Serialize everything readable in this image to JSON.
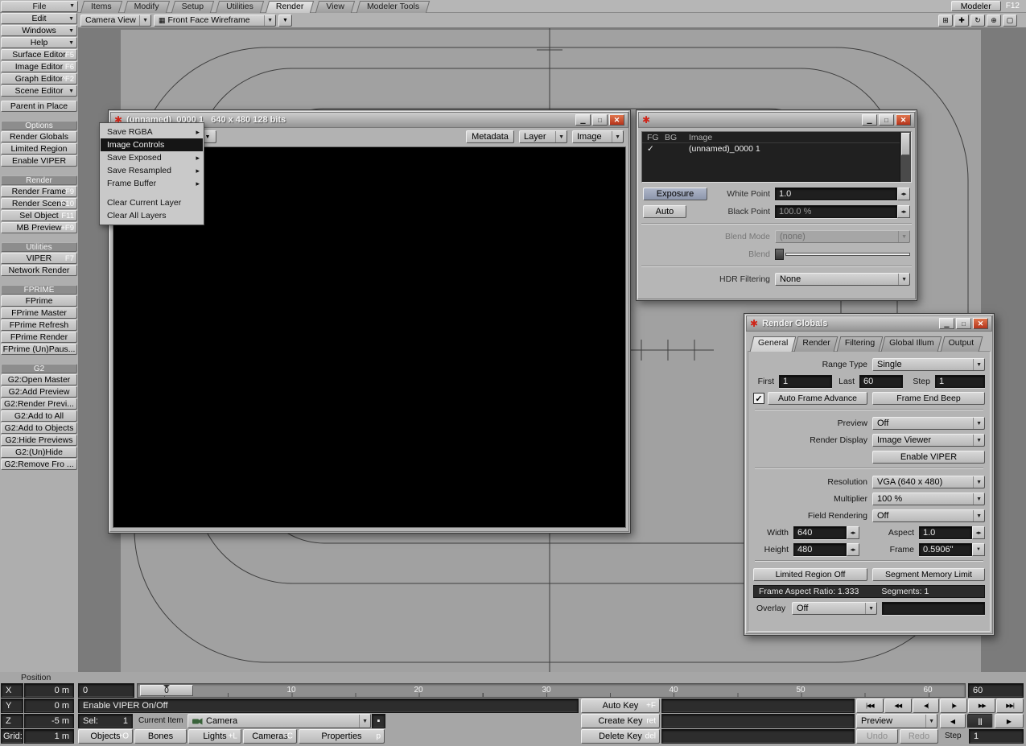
{
  "icons": {
    "dropdown_arrow": "▼",
    "submenu_arrow": "▸",
    "check": "✓",
    "stepper": "◂▸",
    "minimize": "▁",
    "maximize": "□",
    "close": "✕",
    "lightwave_logo": "✱",
    "wireframe_mode": "▦",
    "nav_grid": "⊞",
    "nav_pan": "✚",
    "nav_rotate": "↻",
    "nav_zoom": "⊕",
    "nav_fit": "▢",
    "item_props": "▪"
  },
  "menubar": {
    "file_label": "File",
    "tabs": [
      {
        "label": "Items"
      },
      {
        "label": "Modify"
      },
      {
        "label": "Setup"
      },
      {
        "label": "Utilities"
      },
      {
        "label": "Render",
        "active": true
      },
      {
        "label": "View"
      },
      {
        "label": "Modeler Tools"
      }
    ],
    "modeler_label": "Modeler",
    "modeler_key": "F12"
  },
  "viewbar": {
    "view_mode": "Camera View",
    "shade_mode": "Front Face Wireframe"
  },
  "sidebar": {
    "items": [
      {
        "label": "Edit",
        "menu": true
      },
      {
        "label": "Windows",
        "menu": true
      },
      {
        "label": "Help",
        "menu": true
      },
      {
        "label": "Surface Editor",
        "key": "F5"
      },
      {
        "label": "Image Editor",
        "key": "F6"
      },
      {
        "label": "Graph Editor",
        "key": "^F2"
      },
      {
        "label": "Scene Editor",
        "menu": true
      },
      {
        "gap": true,
        "small": true
      },
      {
        "label": "Parent in Place"
      },
      {
        "gap": true
      },
      {
        "label": "Options",
        "header": true
      },
      {
        "label": "Render Globals"
      },
      {
        "label": "Limited Region"
      },
      {
        "label": "Enable VIPER"
      },
      {
        "gap": true
      },
      {
        "label": "Render",
        "header": true
      },
      {
        "label": "Render Frame",
        "key": "F9"
      },
      {
        "label": "Render Scene",
        "key": "F10"
      },
      {
        "label": "Sel Object",
        "key": "F11"
      },
      {
        "label": "MB Preview",
        "key": "+F9"
      },
      {
        "gap": true
      },
      {
        "label": "Utilities",
        "header": true
      },
      {
        "label": "VIPER",
        "key": "F7"
      },
      {
        "label": "Network Render"
      },
      {
        "gap": true
      },
      {
        "label": "FPRIME",
        "header": true
      },
      {
        "label": "FPrime"
      },
      {
        "label": "FPrime Master"
      },
      {
        "label": "FPrime Refresh"
      },
      {
        "label": "FPrime Render"
      },
      {
        "label": "FPrime (Un)Paus..."
      },
      {
        "gap": true
      },
      {
        "label": "G2",
        "header": true
      },
      {
        "label": "G2:Open Master"
      },
      {
        "label": "G2:Add Preview"
      },
      {
        "label": "G2:Render Previ..."
      },
      {
        "label": "G2:Add to All"
      },
      {
        "label": "G2:Add to Objects"
      },
      {
        "label": "G2:Hide Previews"
      },
      {
        "label": "G2:(Un)Hide"
      },
      {
        "label": "G2:Remove Fro ..."
      }
    ]
  },
  "image_viewer": {
    "title": "(unnamed)_0000 1   640 x 480 128 bits",
    "metadata_label": "Metadata",
    "layer_label": "Layer",
    "image_label": "Image"
  },
  "context_menu": {
    "items": [
      {
        "label": "Save RGBA",
        "submenu": true
      },
      {
        "label": "Image Controls",
        "selected": true
      },
      {
        "label": "Save Exposed",
        "submenu": true
      },
      {
        "label": "Save Resampled",
        "submenu": true
      },
      {
        "label": "Frame Buffer",
        "submenu": true
      },
      {
        "sep": true
      },
      {
        "label": "Clear Current Layer"
      },
      {
        "label": "Clear All Layers"
      }
    ]
  },
  "image_controls": {
    "col_fg": "FG",
    "col_bg": "BG",
    "col_image": "Image",
    "row_image_name": "(unnamed)_0000 1",
    "exposure_label": "Exposure",
    "white_point_label": "White Point",
    "white_point_value": "1.0",
    "auto_label": "Auto",
    "black_point_label": "Black Point",
    "black_point_value": "100.0 %",
    "blend_mode_label": "Blend Mode",
    "blend_mode_value": "(none)",
    "blend_label": "Blend",
    "hdr_filtering_label": "HDR Filtering",
    "hdr_filtering_value": "None"
  },
  "render_globals": {
    "title": "Render Globals",
    "tabs": [
      {
        "label": "General",
        "active": true
      },
      {
        "label": "Render"
      },
      {
        "label": "Filtering"
      },
      {
        "label": "Global Illum"
      },
      {
        "label": "Output"
      }
    ],
    "range_type_label": "Range Type",
    "range_type_value": "Single",
    "first_label": "First",
    "first_value": "1",
    "last_label": "Last",
    "last_value": "60",
    "step_label": "Step",
    "step_value": "1",
    "auto_frame_advance_label": "Auto Frame Advance",
    "frame_end_beep_label": "Frame End Beep",
    "preview_label": "Preview",
    "preview_value": "Off",
    "render_display_label": "Render Display",
    "render_display_value": "Image Viewer",
    "enable_viper_label": "Enable VIPER",
    "resolution_label": "Resolution",
    "resolution_value": "VGA (640 x 480)",
    "multiplier_label": "Multiplier",
    "multiplier_value": "100 %",
    "field_rendering_label": "Field Rendering",
    "field_rendering_value": "Off",
    "width_label": "Width",
    "width_value": "640",
    "aspect_label": "Aspect",
    "aspect_value": "1.0",
    "height_label": "Height",
    "height_value": "480",
    "frame_label": "Frame",
    "frame_value": "0.5906\"",
    "limited_region_label": "Limited Region Off",
    "segment_memory_label": "Segment Memory Limit",
    "frame_aspect_text": "Frame Aspect Ratio: 1.333",
    "segments_text": "Segments: 1",
    "overlay_label": "Overlay",
    "overlay_value": "Off"
  },
  "timeline": {
    "position_label": "Position",
    "ticks": [
      "0",
      "10",
      "20",
      "30",
      "40",
      "50",
      "60"
    ],
    "handle_value": "0",
    "current_frame": "0",
    "end_frame": "60"
  },
  "coords": {
    "x_label": "X",
    "x_value": "0 m",
    "y_label": "Y",
    "y_value": "0 m",
    "z_label": "Z",
    "z_value": "-5 m",
    "grid_label": "Grid:",
    "grid_value": "1 m"
  },
  "bottom": {
    "viper_hint": "Enable VIPER On/Off",
    "auto_key_label": "Auto Key",
    "auto_key_key": "+F",
    "create_key_label": "Create Key",
    "create_key_key": "ret",
    "delete_key_label": "Delete Key",
    "delete_key_key": "del",
    "sel_label": "Sel:",
    "sel_value": "1",
    "current_item_label": "Current Item",
    "current_item_value": "Camera",
    "objects_label": "Objects",
    "objects_key": "+O",
    "bones_label": "Bones",
    "bones_key": "",
    "lights_label": "Lights",
    "lights_key": "+L",
    "cameras_label": "Cameras",
    "cameras_key": "+C",
    "properties_label": "Properties",
    "properties_key": "p",
    "preview_label": "Preview",
    "undo_label": "Undo",
    "redo_label": "Redo",
    "step_label": "Step",
    "step_value": "1",
    "playback": [
      "|◀◀",
      "◀◀",
      "◀|",
      "|▶",
      "▶▶",
      "▶▶|"
    ],
    "transport_prev": "◀",
    "transport_pause": "||",
    "transport_next": "▶"
  }
}
